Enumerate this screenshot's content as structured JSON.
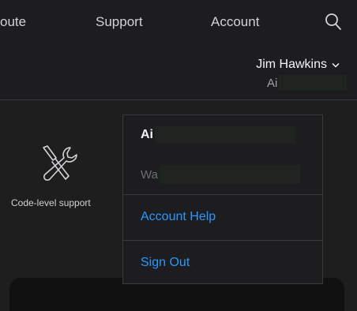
{
  "nav": {
    "items": [
      {
        "label": "oute"
      },
      {
        "label": "Support"
      },
      {
        "label": "Account"
      }
    ],
    "search_icon": "search-icon"
  },
  "account": {
    "name": "Jim Hawkins",
    "chevron_icon": "chevron-down-icon",
    "sub_prefix": "Ai"
  },
  "content": {
    "support_label": "Code-level support",
    "support_icon": "tools-icon"
  },
  "dropdown": {
    "user_line1_prefix": "Ai",
    "user_line2_prefix": "Wa",
    "account_help": "Account Help",
    "sign_out": "Sign Out"
  },
  "colors": {
    "background": "#1e1e1e",
    "nav_background": "#1d1d1f",
    "link": "#2997ff",
    "text": "#f5f5f7",
    "muted": "#a1a1a6",
    "redaction": "#202420"
  }
}
